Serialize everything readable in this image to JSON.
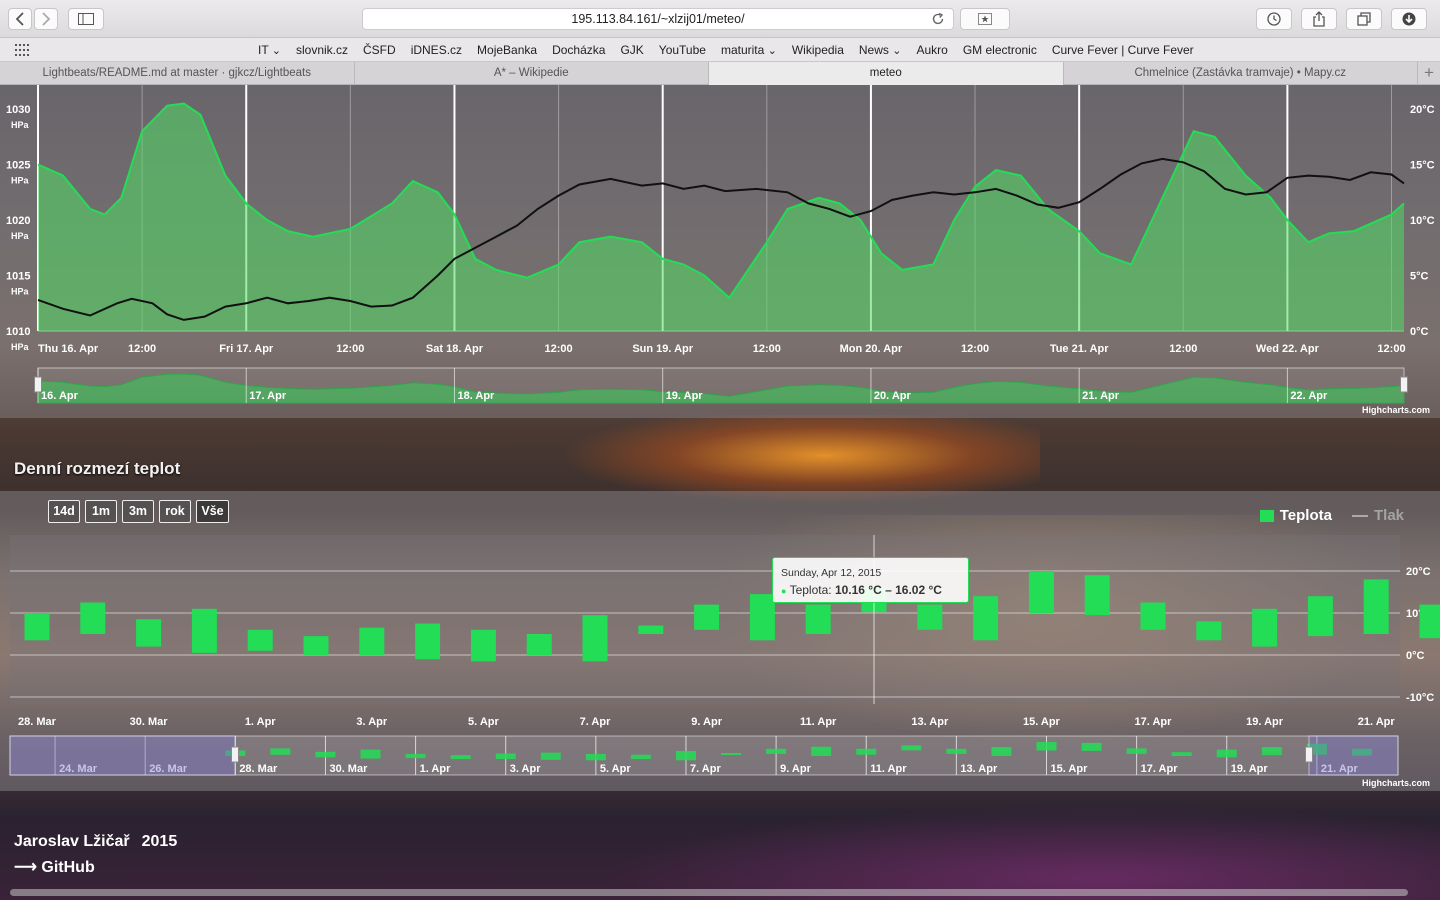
{
  "browser": {
    "url": "195.113.84.161/~xlzij01/meteo/",
    "bookmarks": [
      "IT",
      "slovnik.cz",
      "ČSFD",
      "iDNES.cz",
      "MojeBanka",
      "Docházka",
      "GJK",
      "YouTube",
      "maturita",
      "Wikipedia",
      "News",
      "Aukro",
      "GM electronic",
      "Curve Fever | Curve Fever"
    ],
    "bookmark_menus": [
      "IT",
      "maturita",
      "News"
    ],
    "tabs": [
      {
        "title": "Lightbeats/README.md at master · gjkcz/Lightbeats",
        "active": false
      },
      {
        "title": "A* – Wikipedie",
        "active": false
      },
      {
        "title": "meteo",
        "active": true
      },
      {
        "title": "Chmelnice (Zastávka tramvaje) • Mapy.cz",
        "active": false
      }
    ]
  },
  "hourly_chart": {
    "pressure_axis_labels": [
      "1030",
      "1025",
      "1020",
      "1015",
      "1010"
    ],
    "pressure_unit": "HPa",
    "temp_axis_labels": [
      "20°C",
      "15°C",
      "10°C",
      "5°C",
      "0°C"
    ],
    "x_labels": [
      "Thu 16. Apr",
      "12:00",
      "Fri 17. Apr",
      "12:00",
      "Sat 18. Apr",
      "12:00",
      "Sun 19. Apr",
      "12:00",
      "Mon 20. Apr",
      "12:00",
      "Tue 21. Apr",
      "12:00",
      "Wed 22. Apr",
      "12:00"
    ],
    "navigator_labels": [
      "16. Apr",
      "17. Apr",
      "18. Apr",
      "19. Apr",
      "20. Apr",
      "21. Apr",
      "22. Apr"
    ],
    "credits": "Highcharts.com"
  },
  "daily_section_title": "Denní rozmezí teplot",
  "daily_chart": {
    "range_buttons": [
      "14d",
      "1m",
      "3m",
      "rok",
      "Vše"
    ],
    "selected_range": "Vše",
    "legend": {
      "temperature": "Teplota",
      "pressure": "Tlak"
    },
    "y_labels": [
      "20°C",
      "10°C",
      "0°C",
      "-10°C"
    ],
    "x_labels": [
      "28. Mar",
      "30. Mar",
      "1. Apr",
      "3. Apr",
      "5. Apr",
      "7. Apr",
      "9. Apr",
      "11. Apr",
      "13. Apr",
      "15. Apr",
      "17. Apr",
      "19. Apr",
      "21. Apr"
    ],
    "navigator_labels": [
      "24. Mar",
      "26. Mar",
      "28. Mar",
      "30. Mar",
      "1. Apr",
      "3. Apr",
      "5. Apr",
      "7. Apr",
      "9. Apr",
      "11. Apr",
      "13. Apr",
      "15. Apr",
      "17. Apr",
      "19. Apr",
      "21. Apr"
    ],
    "tooltip": {
      "date": "Sunday, Apr 12, 2015",
      "series": "Teplota",
      "value": "10.16 °C – 16.02 °C"
    },
    "credits": "Highcharts.com"
  },
  "footer": {
    "author": "Jaroslav Lžičař",
    "year": "2015",
    "github": "GitHub",
    "github_arrow": "⟶"
  },
  "colors": {
    "temperature": "#22dd55",
    "pressure": "#111111"
  },
  "chart_data": [
    {
      "type": "line",
      "title": "",
      "x_unit": "days from Thu 16. Apr 00:00",
      "series": [
        {
          "name": "Teplota",
          "axis": "right",
          "style": "area",
          "points": [
            [
              0,
              15
            ],
            [
              0.12,
              14
            ],
            [
              0.25,
              11
            ],
            [
              0.32,
              10.5
            ],
            [
              0.4,
              12
            ],
            [
              0.5,
              18
            ],
            [
              0.62,
              20.3
            ],
            [
              0.7,
              20.5
            ],
            [
              0.78,
              19.5
            ],
            [
              0.9,
              14
            ],
            [
              1.0,
              11.5
            ],
            [
              1.1,
              10
            ],
            [
              1.2,
              9
            ],
            [
              1.32,
              8.5
            ],
            [
              1.5,
              9.2
            ],
            [
              1.7,
              11.5
            ],
            [
              1.8,
              13.5
            ],
            [
              1.92,
              12.5
            ],
            [
              2.0,
              10.5
            ],
            [
              2.1,
              6.5
            ],
            [
              2.2,
              5.5
            ],
            [
              2.35,
              4.8
            ],
            [
              2.5,
              6
            ],
            [
              2.6,
              8
            ],
            [
              2.75,
              8.5
            ],
            [
              2.9,
              8
            ],
            [
              3.0,
              6.5
            ],
            [
              3.1,
              6
            ],
            [
              3.2,
              5
            ],
            [
              3.32,
              3
            ],
            [
              3.5,
              8
            ],
            [
              3.6,
              11
            ],
            [
              3.75,
              12
            ],
            [
              3.85,
              11.5
            ],
            [
              3.95,
              10
            ],
            [
              4.05,
              7
            ],
            [
              4.15,
              5.5
            ],
            [
              4.3,
              6
            ],
            [
              4.4,
              10
            ],
            [
              4.5,
              13
            ],
            [
              4.6,
              14.5
            ],
            [
              4.72,
              14
            ],
            [
              4.85,
              11
            ],
            [
              5.0,
              9
            ],
            [
              5.1,
              7
            ],
            [
              5.25,
              6
            ],
            [
              5.35,
              10
            ],
            [
              5.45,
              14
            ],
            [
              5.55,
              18
            ],
            [
              5.65,
              17.5
            ],
            [
              5.8,
              14
            ],
            [
              5.92,
              12
            ],
            [
              6.0,
              10
            ],
            [
              6.1,
              8
            ],
            [
              6.2,
              8.8
            ],
            [
              6.32,
              9
            ],
            [
              6.5,
              10.5
            ],
            [
              6.56,
              11.5
            ]
          ]
        },
        {
          "name": "Tlak",
          "axis": "left",
          "style": "line",
          "points": [
            [
              0,
              1012.8
            ],
            [
              0.12,
              1012
            ],
            [
              0.25,
              1011.4
            ],
            [
              0.38,
              1012.5
            ],
            [
              0.45,
              1012.9
            ],
            [
              0.55,
              1012.5
            ],
            [
              0.62,
              1011.5
            ],
            [
              0.7,
              1011
            ],
            [
              0.8,
              1011.3
            ],
            [
              0.9,
              1012.2
            ],
            [
              1.0,
              1012.5
            ],
            [
              1.1,
              1013
            ],
            [
              1.2,
              1012.5
            ],
            [
              1.3,
              1012.7
            ],
            [
              1.4,
              1013
            ],
            [
              1.5,
              1012.7
            ],
            [
              1.6,
              1012.2
            ],
            [
              1.7,
              1012.3
            ],
            [
              1.8,
              1013
            ],
            [
              1.92,
              1015
            ],
            [
              2.0,
              1016.5
            ],
            [
              2.1,
              1017.5
            ],
            [
              2.2,
              1018.5
            ],
            [
              2.3,
              1019.5
            ],
            [
              2.4,
              1021
            ],
            [
              2.5,
              1022.2
            ],
            [
              2.6,
              1023.2
            ],
            [
              2.75,
              1023.7
            ],
            [
              2.9,
              1023.1
            ],
            [
              3.0,
              1023.3
            ],
            [
              3.1,
              1022.8
            ],
            [
              3.2,
              1023.1
            ],
            [
              3.3,
              1022.6
            ],
            [
              3.45,
              1022.8
            ],
            [
              3.6,
              1022.5
            ],
            [
              3.7,
              1021.5
            ],
            [
              3.8,
              1021
            ],
            [
              3.9,
              1020.3
            ],
            [
              4.0,
              1020.8
            ],
            [
              4.1,
              1021.8
            ],
            [
              4.2,
              1022.2
            ],
            [
              4.3,
              1022.5
            ],
            [
              4.4,
              1022.3
            ],
            [
              4.5,
              1022.5
            ],
            [
              4.6,
              1022.8
            ],
            [
              4.7,
              1022.2
            ],
            [
              4.8,
              1021.4
            ],
            [
              4.9,
              1021.1
            ],
            [
              5.0,
              1021.6
            ],
            [
              5.1,
              1022.8
            ],
            [
              5.2,
              1024.1
            ],
            [
              5.3,
              1025.1
            ],
            [
              5.4,
              1025.5
            ],
            [
              5.5,
              1025.2
            ],
            [
              5.6,
              1024.4
            ],
            [
              5.7,
              1022.8
            ],
            [
              5.8,
              1022.3
            ],
            [
              5.9,
              1022.5
            ],
            [
              6.0,
              1023.8
            ],
            [
              6.1,
              1024
            ],
            [
              6.2,
              1023.9
            ],
            [
              6.3,
              1023.6
            ],
            [
              6.4,
              1024.3
            ],
            [
              6.5,
              1024.1
            ],
            [
              6.56,
              1023.3
            ]
          ]
        }
      ],
      "ylim_left": [
        1010,
        1030
      ],
      "ylim_right": [
        0,
        20
      ]
    },
    {
      "type": "columnrange",
      "title": "Denní rozmezí teplot",
      "series": [
        {
          "name": "Teplota",
          "x": [
            "28. Mar",
            "29. Mar",
            "30. Mar",
            "31. Mar",
            "1. Apr",
            "2. Apr",
            "3. Apr",
            "4. Apr",
            "5. Apr",
            "6. Apr",
            "7. Apr",
            "8. Apr",
            "9. Apr",
            "10. Apr",
            "11. Apr",
            "12. Apr",
            "13. Apr",
            "14. Apr",
            "15. Apr",
            "16. Apr",
            "17. Apr",
            "18. Apr",
            "19. Apr",
            "20. Apr",
            "21. Apr",
            "22. Apr"
          ],
          "ranges": [
            [
              3.5,
              10
            ],
            [
              5,
              12.5
            ],
            [
              2,
              8.5
            ],
            [
              0.5,
              11
            ],
            [
              1,
              6
            ],
            [
              0,
              4.5
            ],
            [
              0,
              6.5
            ],
            [
              -1,
              7.5
            ],
            [
              -1.5,
              6
            ],
            [
              0,
              5
            ],
            [
              -1.5,
              9.5
            ],
            [
              5,
              7
            ],
            [
              6,
              12
            ],
            [
              3.5,
              14.5
            ],
            [
              5,
              12
            ],
            [
              10.2,
              16
            ],
            [
              6,
              12
            ],
            [
              3.5,
              14
            ],
            [
              10,
              20
            ],
            [
              9.5,
              19
            ],
            [
              6,
              12.5
            ],
            [
              3.5,
              8
            ],
            [
              2,
              11
            ],
            [
              4.5,
              14
            ],
            [
              5,
              18
            ],
            [
              4,
              12
            ]
          ]
        }
      ],
      "ylim": [
        -10,
        25
      ]
    }
  ]
}
